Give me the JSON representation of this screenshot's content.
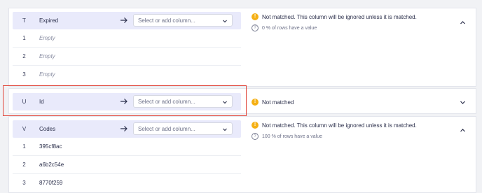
{
  "select_placeholder": "Select or add column...",
  "columns": [
    {
      "letter": "T",
      "name": "Expired",
      "status": "Not matched. This column will be ignored unless it is matched.",
      "percent_text": "0 % of rows have a value",
      "rows": [
        {
          "index": "1",
          "value": "Empty"
        },
        {
          "index": "2",
          "value": "Empty"
        },
        {
          "index": "3",
          "value": "Empty"
        }
      ]
    },
    {
      "letter": "U",
      "name": "Id",
      "status": "Not matched"
    },
    {
      "letter": "V",
      "name": "Codes",
      "status": "Not matched. This column will be ignored unless it is matched.",
      "percent_text": "100 % of rows have a value",
      "rows": [
        {
          "index": "1",
          "value": "395cf8ac"
        },
        {
          "index": "2",
          "value": "a6b2c54e"
        },
        {
          "index": "3",
          "value": "8770f259"
        }
      ]
    }
  ],
  "colors": {
    "highlight": "#e1463a",
    "warning": "#f5b014",
    "header_bg": "#e9eafb"
  },
  "icons": [
    "arrow-right-icon",
    "chevron-down-icon",
    "warning-icon",
    "question-icon",
    "chevron-up-icon"
  ]
}
